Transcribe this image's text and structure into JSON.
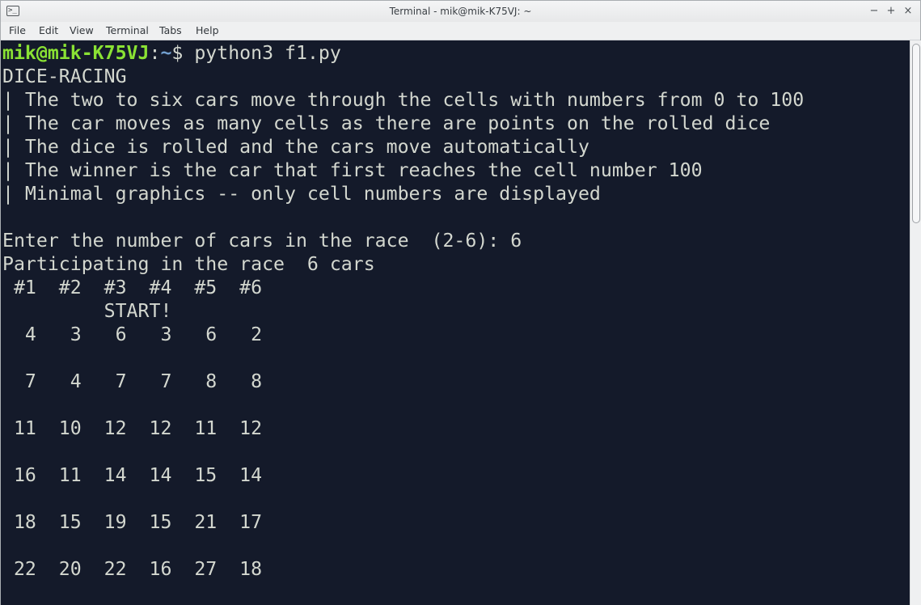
{
  "window": {
    "title": "Terminal - mik@mik-K75VJ: ~"
  },
  "app_icon_glyph": ">_",
  "controls": {
    "minimize": "−",
    "maximize": "+",
    "close": "×"
  },
  "menu": [
    "File",
    "Edit",
    "View",
    "Terminal",
    "Tabs",
    "Help"
  ],
  "prompt": {
    "user_host": "mik@mik-K75VJ",
    "sep": ":",
    "path": "~",
    "symbol": "$ ",
    "command": "python3 f1.py"
  },
  "output": [
    "DICE-RACING",
    "| The two to six cars move through the cells with numbers from 0 to 100",
    "| The car moves as many cells as there are points on the rolled dice",
    "| The dice is rolled and the cars move automatically",
    "| The winner is the car that first reaches the cell number 100",
    "| Minimal graphics -- only cell numbers are displayed",
    "",
    "Enter the number of cars in the race  (2-6): 6",
    "Participating in the race  6 cars",
    " #1  #2  #3  #4  #5  #6",
    "         START!",
    "  4   3   6   3   6   2",
    "",
    "  7   4   7   7   8   8",
    "",
    " 11  10  12  12  11  12",
    "",
    " 16  11  14  14  15  14",
    "",
    " 18  15  19  15  21  17",
    "",
    " 22  20  22  16  27  18"
  ],
  "colors": {
    "terminal_bg": "#141a2a",
    "text": "#d3d7cf",
    "user_host": "#8ae234",
    "path": "#729fcf"
  }
}
